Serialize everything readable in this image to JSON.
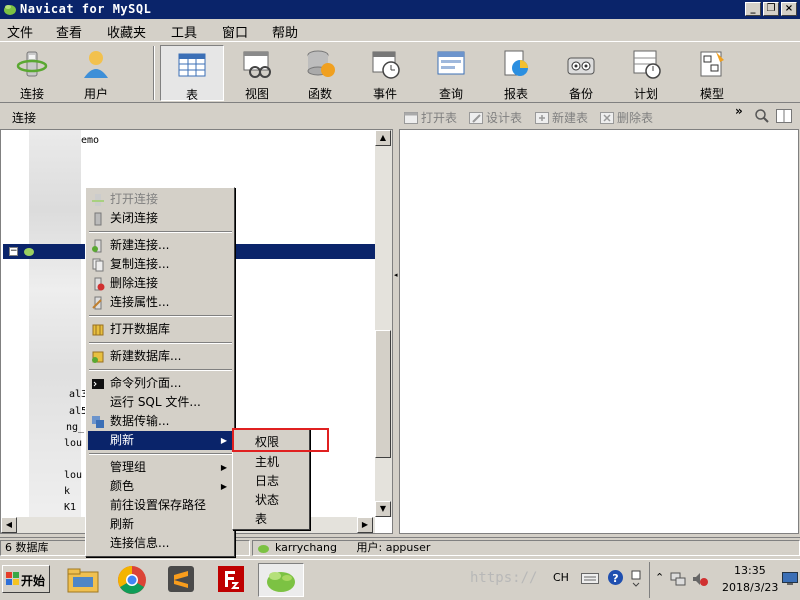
{
  "window": {
    "title": "Navicat for MySQL"
  },
  "menu": [
    "文件",
    "查看",
    "收藏夹",
    "工具",
    "窗口",
    "帮助"
  ],
  "toolbar": {
    "buttons": [
      {
        "label": "连接",
        "icon": "connection-icon"
      },
      {
        "label": "用户",
        "icon": "user-icon"
      },
      {
        "label": "表",
        "icon": "table-icon",
        "active": true
      },
      {
        "label": "视图",
        "icon": "view-icon"
      },
      {
        "label": "函数",
        "icon": "function-icon"
      },
      {
        "label": "事件",
        "icon": "event-icon"
      },
      {
        "label": "查询",
        "icon": "query-icon"
      },
      {
        "label": "报表",
        "icon": "report-icon"
      },
      {
        "label": "备份",
        "icon": "backup-icon"
      },
      {
        "label": "计划",
        "icon": "schedule-icon"
      },
      {
        "label": "模型",
        "icon": "model-icon"
      }
    ],
    "more": "»"
  },
  "subbar": {
    "connection_label": "连接",
    "actions": [
      "打开表",
      "设计表",
      "新建表",
      "删除表"
    ]
  },
  "tree": {
    "fragments": [
      "emo",
      "al3",
      "al5",
      "ng_",
      "lou",
      "lou",
      "k",
      "K1"
    ]
  },
  "context_menu": {
    "items": [
      {
        "label": "打开连接",
        "disabled": true,
        "icon": "open-connection-icon"
      },
      {
        "label": "关闭连接",
        "icon": "close-connection-icon"
      },
      {
        "label": "新建连接...",
        "icon": "new-connection-icon"
      },
      {
        "label": "复制连接...",
        "icon": "copy-connection-icon"
      },
      {
        "label": "删除连接",
        "icon": "delete-connection-icon"
      },
      {
        "label": "连接属性...",
        "icon": "connection-properties-icon"
      },
      {
        "label": "打开数据库",
        "icon": "open-database-icon"
      },
      {
        "label": "新建数据库...",
        "icon": "new-database-icon"
      },
      {
        "label": "命令列介面...",
        "icon": "console-icon"
      },
      {
        "label": "运行 SQL 文件..."
      },
      {
        "label": "数据传输...",
        "icon": "data-transfer-icon"
      },
      {
        "label": "刷新",
        "highlighted": true,
        "has_submenu": true
      },
      {
        "label": "管理组",
        "has_submenu": true
      },
      {
        "label": "颜色",
        "has_submenu": true
      },
      {
        "label": "前往设置保存路径"
      },
      {
        "label": "刷新"
      },
      {
        "label": "连接信息..."
      }
    ]
  },
  "submenu": {
    "items": [
      "权限",
      "主机",
      "日志",
      "状态",
      "表"
    ]
  },
  "statusbar": {
    "db_count": "6 数据库",
    "connection": "karrychang",
    "user": "用户: appuser"
  },
  "taskbar": {
    "start_label": "开始",
    "watermark": "https://",
    "lang": "CH",
    "time": "13:35",
    "date": "2018/3/23"
  },
  "colors": {
    "highlight": "#0a246a",
    "annotation_box": "#e02020"
  }
}
